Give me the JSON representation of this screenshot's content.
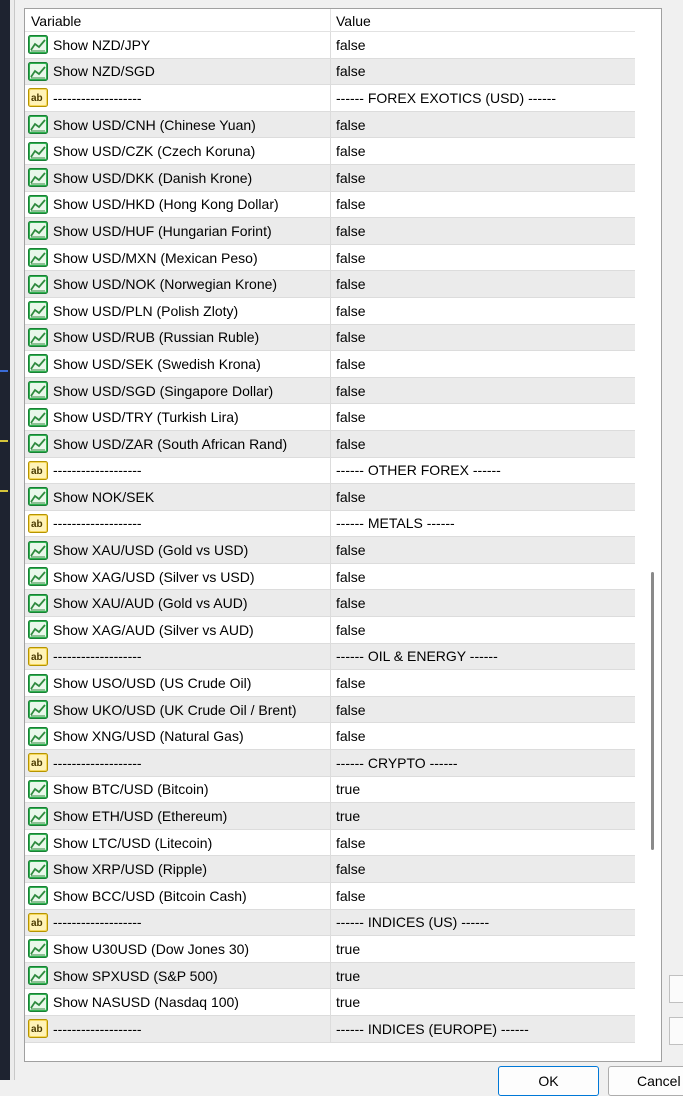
{
  "header": {
    "variable": "Variable",
    "value": "Value"
  },
  "rows": [
    {
      "type": "chart",
      "name": "Show NZD/JPY",
      "value": "false"
    },
    {
      "type": "chart",
      "name": "Show NZD/SGD",
      "value": "false"
    },
    {
      "type": "text",
      "name": "-------------------",
      "value": "------ FOREX EXOTICS (USD) ------"
    },
    {
      "type": "chart",
      "name": "Show USD/CNH (Chinese Yuan)",
      "value": "false"
    },
    {
      "type": "chart",
      "name": "Show USD/CZK (Czech Koruna)",
      "value": "false"
    },
    {
      "type": "chart",
      "name": "Show USD/DKK (Danish Krone)",
      "value": "false"
    },
    {
      "type": "chart",
      "name": "Show USD/HKD (Hong Kong Dollar)",
      "value": "false"
    },
    {
      "type": "chart",
      "name": "Show USD/HUF (Hungarian Forint)",
      "value": "false"
    },
    {
      "type": "chart",
      "name": "Show USD/MXN (Mexican Peso)",
      "value": "false"
    },
    {
      "type": "chart",
      "name": "Show USD/NOK (Norwegian Krone)",
      "value": "false"
    },
    {
      "type": "chart",
      "name": "Show USD/PLN (Polish Zloty)",
      "value": "false"
    },
    {
      "type": "chart",
      "name": "Show USD/RUB (Russian Ruble)",
      "value": "false"
    },
    {
      "type": "chart",
      "name": "Show USD/SEK (Swedish Krona)",
      "value": "false"
    },
    {
      "type": "chart",
      "name": "Show USD/SGD (Singapore Dollar)",
      "value": "false"
    },
    {
      "type": "chart",
      "name": "Show USD/TRY (Turkish Lira)",
      "value": "false"
    },
    {
      "type": "chart",
      "name": "Show USD/ZAR (South African Rand)",
      "value": "false"
    },
    {
      "type": "text",
      "name": "-------------------",
      "value": "------ OTHER FOREX ------"
    },
    {
      "type": "chart",
      "name": "Show NOK/SEK",
      "value": "false"
    },
    {
      "type": "text",
      "name": "-------------------",
      "value": "------ METALS ------"
    },
    {
      "type": "chart",
      "name": "Show XAU/USD (Gold vs USD)",
      "value": "false"
    },
    {
      "type": "chart",
      "name": "Show XAG/USD (Silver vs USD)",
      "value": "false"
    },
    {
      "type": "chart",
      "name": "Show XAU/AUD (Gold vs AUD)",
      "value": "false"
    },
    {
      "type": "chart",
      "name": "Show XAG/AUD (Silver vs AUD)",
      "value": "false"
    },
    {
      "type": "text",
      "name": "-------------------",
      "value": "------ OIL & ENERGY ------"
    },
    {
      "type": "chart",
      "name": "Show USO/USD (US Crude Oil)",
      "value": "false"
    },
    {
      "type": "chart",
      "name": "Show UKO/USD (UK Crude Oil / Brent)",
      "value": "false"
    },
    {
      "type": "chart",
      "name": "Show XNG/USD (Natural Gas)",
      "value": "false"
    },
    {
      "type": "text",
      "name": "-------------------",
      "value": "------ CRYPTO ------"
    },
    {
      "type": "chart",
      "name": "Show BTC/USD (Bitcoin)",
      "value": "true"
    },
    {
      "type": "chart",
      "name": "Show ETH/USD (Ethereum)",
      "value": "true"
    },
    {
      "type": "chart",
      "name": "Show LTC/USD (Litecoin)",
      "value": "false"
    },
    {
      "type": "chart",
      "name": "Show XRP/USD (Ripple)",
      "value": "false"
    },
    {
      "type": "chart",
      "name": "Show BCC/USD (Bitcoin Cash)",
      "value": "false"
    },
    {
      "type": "text",
      "name": "-------------------",
      "value": "------ INDICES (US) ------"
    },
    {
      "type": "chart",
      "name": "Show U30USD (Dow Jones 30)",
      "value": "true"
    },
    {
      "type": "chart",
      "name": "Show SPXUSD (S&P 500)",
      "value": "true"
    },
    {
      "type": "chart",
      "name": "Show NASUSD (Nasdaq 100)",
      "value": "true"
    },
    {
      "type": "text",
      "name": "-------------------",
      "value": "------ INDICES (EUROPE) ------"
    }
  ],
  "buttons": {
    "ok": "OK",
    "cancel": "Cancel"
  },
  "icons": {
    "chart": "chart-icon",
    "text": "ab-text-icon"
  },
  "colors": {
    "chart_icon": "#2fb150",
    "text_icon": "#e8c400",
    "row_alt": "#ebebeb",
    "ok_border": "#0078d7"
  }
}
